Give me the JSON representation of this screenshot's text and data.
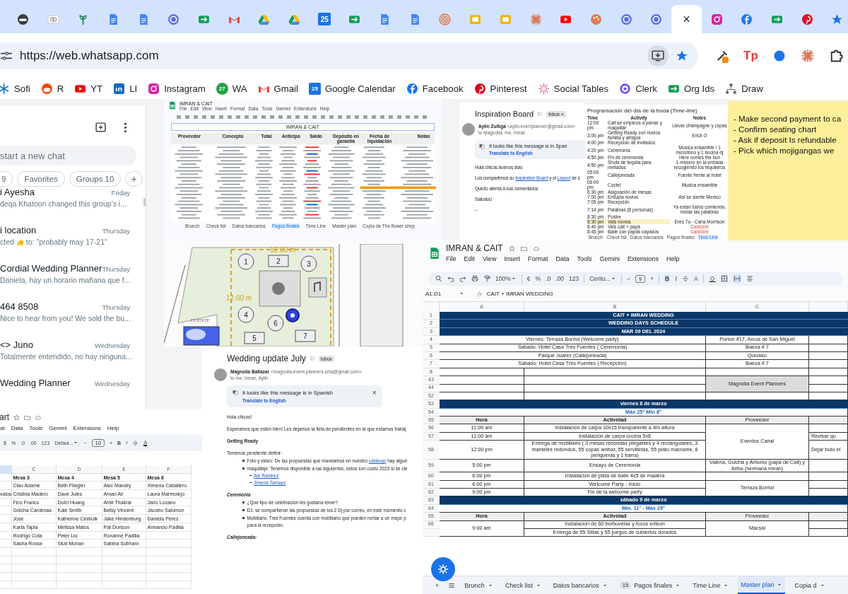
{
  "browser": {
    "tabs": [
      {
        "kind": "mask",
        "selected": false
      },
      {
        "kind": "rings",
        "selected": false
      },
      {
        "kind": "plant",
        "selected": false
      },
      {
        "kind": "doc",
        "selected": false
      },
      {
        "kind": "doc",
        "selected": false
      },
      {
        "kind": "circle",
        "selected": false
      },
      {
        "kind": "meet",
        "selected": false
      },
      {
        "kind": "gmail",
        "selected": false
      },
      {
        "kind": "drive",
        "selected": false
      },
      {
        "kind": "drive",
        "selected": false
      },
      {
        "kind": "calendar",
        "label": "25",
        "selected": false
      },
      {
        "kind": "meet",
        "selected": false
      },
      {
        "kind": "doc",
        "selected": false
      },
      {
        "kind": "doc",
        "selected": false
      },
      {
        "kind": "spiral",
        "selected": false
      },
      {
        "kind": "slides",
        "selected": false
      },
      {
        "kind": "slides",
        "selected": false
      },
      {
        "kind": "burst",
        "selected": false
      },
      {
        "kind": "youtube",
        "selected": false
      },
      {
        "kind": "palette",
        "selected": false
      },
      {
        "kind": "circle",
        "selected": false
      },
      {
        "kind": "circle",
        "selected": false
      },
      {
        "kind": "blank",
        "close": "×",
        "selected": true
      },
      {
        "kind": "instagram",
        "selected": false
      },
      {
        "kind": "facebook",
        "selected": false
      },
      {
        "kind": "meet",
        "selected": false
      },
      {
        "kind": "pinterest",
        "selected": false
      },
      {
        "kind": "star",
        "selected": false
      }
    ],
    "address": {
      "url": "https://web.whatsapp.com"
    },
    "extensions": [
      {
        "kind": "eyedropper"
      },
      {
        "kind": "text",
        "label": "Tp"
      },
      {
        "kind": "dot"
      },
      {
        "kind": "burst"
      },
      {
        "kind": "puzzle"
      }
    ],
    "bookmarks": [
      {
        "label": "Sofi",
        "kind": "snow"
      },
      {
        "label": "R",
        "kind": "reddit"
      },
      {
        "label": "YT",
        "kind": "youtube"
      },
      {
        "label": "LI",
        "kind": "linkedin"
      },
      {
        "label": "Instagram",
        "kind": "instagram"
      },
      {
        "label": "WA",
        "kind": "wa",
        "icon_text": "27"
      },
      {
        "label": "Gmail",
        "kind": "gmail"
      },
      {
        "label": "Google Calendar",
        "kind": "calendar",
        "icon_text": "25"
      },
      {
        "label": "Facebook",
        "kind": "facebook"
      },
      {
        "label": "Pinterest",
        "kind": "pinterest"
      },
      {
        "label": "Social Tables",
        "kind": "sun"
      },
      {
        "label": "Clerk",
        "kind": "clerk"
      },
      {
        "label": "Org Ids",
        "kind": "meet"
      },
      {
        "label": "Draw",
        "kind": "draw"
      }
    ]
  },
  "whatsapp": {
    "search": {
      "placeholder": "start a new chat"
    },
    "filters": [
      {
        "label": "9",
        "selected": false
      },
      {
        "label": "Favorites",
        "selected": false
      },
      {
        "label": "Groups 10",
        "selected": false
      }
    ],
    "add_filter": "+",
    "chats": [
      {
        "name": "i Ayesha",
        "time": "Friday",
        "preview": "deqa Khatoon changed this group's i..."
      },
      {
        "name": "i location",
        "time": "Thursday",
        "preview": "cted",
        "preview_tail": "to: \"probably may 17-21\""
      },
      {
        "name": "Cordial Wedding Planner",
        "time": "Thursday",
        "preview": "Daniela, hay un horario mañana que f..."
      },
      {
        "name": "464 8508",
        "time": "Thursday",
        "preview": "Nice to hear from you! We sold the bu..."
      },
      {
        "name": "<> Juno",
        "time": "Wednesday",
        "preview": "Totalmente entendido, no hay ninguna..."
      },
      {
        "name": "Wedding Planner",
        "time": "Wednesday"
      }
    ]
  },
  "payments_sheet": {
    "title": "IMRAN & CAIT",
    "menu": [
      "File",
      "Edit",
      "View",
      "Insert",
      "Format",
      "Data",
      "Tools",
      "Gemini",
      "Extensions",
      "Help"
    ],
    "sheet_title": "IMRAN & CAIT",
    "columns": [
      "Proveedor",
      "Concepto",
      "Total",
      "Anticipo",
      "Saldo",
      "Depósito en garantía",
      "Fecha de liquidación",
      "Notas"
    ],
    "tabs": [
      {
        "label": "Brunch",
        "selected": false
      },
      {
        "label": "Check list",
        "selected": false
      },
      {
        "label": "Datos bancarios",
        "selected": false
      },
      {
        "label": "Pagos finales",
        "selected": true
      },
      {
        "label": "Time Line",
        "selected": false
      },
      {
        "label": "Master plan",
        "selected": false
      },
      {
        "label": "Copia de The flower shop",
        "selected": false
      }
    ]
  },
  "floor_plan": {
    "tables": [
      {
        "label": "1",
        "kind": "round"
      },
      {
        "label": "2",
        "kind": "long"
      },
      {
        "label": "3",
        "kind": "round"
      },
      {
        "label": "4",
        "kind": "round"
      },
      {
        "label": "5",
        "kind": "long"
      },
      {
        "label": "6",
        "kind": "round"
      },
      {
        "label": "7",
        "kind": "long"
      }
    ],
    "measures": [
      "12.00 m",
      "12.00 m"
    ],
    "area_label": "FUENTE"
  },
  "inspiration_email": {
    "subject": "Inspiration Board",
    "label": "Inbox",
    "label_remove": "×",
    "sender": "Aylin Zuñiga",
    "address": "<aylin.eventplanner@gmail.com>",
    "recipients": "to Magnolia, me, Imran",
    "banner": "It looks like this message is in Span",
    "translate": "Translate to English",
    "body": [
      {
        "parts": [
          {
            "text": "Hola chicos buenos días",
            "link": false
          }
        ]
      },
      {
        "parts": [
          {
            "text": "Los compartimos su ",
            "link": false
          },
          {
            "text": "Inspiration Board",
            "link": true
          },
          {
            "text": " y el ",
            "link": false
          },
          {
            "text": "Layout",
            "link": true
          },
          {
            "text": " de s",
            "link": false
          }
        ]
      },
      {
        "parts": [
          {
            "text": "Quedo atenta a sus comentarios",
            "link": false
          }
        ]
      },
      {
        "parts": [
          {
            "text": "Saludos!",
            "link": false
          }
        ]
      },
      {
        "parts": [
          {
            "text": "--",
            "link": false
          }
        ]
      }
    ]
  },
  "timeline_sheet": {
    "title": "Programación del día de la boda (Time-line)",
    "columns": [
      "Time",
      "Activity",
      "Notes"
    ],
    "rows": [
      {
        "time": "12:00 pm",
        "activity": "Cait se empieza a peinar y maquillar",
        "note": "Llevar champagne y copas",
        "highlighted": false,
        "alert": false
      },
      {
        "time": "3:00 pm",
        "activity": "Getting Ready con novios familia y amigos",
        "note": "Erick O",
        "highlighted": false,
        "alert": false
      },
      {
        "time": "4:00 pm",
        "activity": "Recepcion de invitados",
        "highlighted": false
      },
      {
        "time": "4:20 pm",
        "activity": "Ceremonia",
        "note": "Musica ensamble / 1 microfono y 1 bocina dj",
        "highlighted": false,
        "alert": false
      },
      {
        "time": "4:50 pm",
        "activity": "Fin de ceremonia",
        "note": "Here comes the sun",
        "highlighted": false,
        "alert": false
      },
      {
        "time": "4:50 pm",
        "activity": "Shots de tequila para invitados",
        "note": "1 mesero en la entrada recogiendo los tequileros",
        "highlighted": false,
        "alert": false
      },
      {
        "time": "05:00 pm",
        "activity": "Callejoneada",
        "note": "Fuente frente al hotel",
        "highlighted": false,
        "alert": false
      },
      {
        "time": "06:00 pm",
        "activity": "Coctel",
        "note": "Musica ensamble",
        "highlighted": false,
        "alert": false
      },
      {
        "time": "6:30 pm",
        "activity": "Asignación de mesas",
        "highlighted": false
      },
      {
        "time": "7:00 pm",
        "activity": "Entrada novios",
        "note": "Así se siente Mexico",
        "highlighted": false,
        "alert": false
      },
      {
        "time": "7:05 pm",
        "activity": "Recepción",
        "highlighted": false
      },
      {
        "time": "7:14 pm",
        "activity": "Palabras (8 personas)",
        "note": "Ya estan todos comiendo, iniciar las palabras",
        "highlighted": false,
        "alert": false
      },
      {
        "time": "8:30 pm",
        "activity": "Postre",
        "highlighted": false
      },
      {
        "time": "8:30 pm",
        "activity": "Vals novios",
        "note": "Eres Tu - Carla Morrison",
        "highlighted": true,
        "alert": false
      },
      {
        "time": "8:40 pm",
        "activity": "Vals cait + papá",
        "note": "Canción!",
        "highlighted": false,
        "alert": true
      },
      {
        "time": "8:45 pm",
        "activity": "Baile con papás cayados",
        "note": "Canción!",
        "highlighted": false,
        "alert": true
      }
    ],
    "tabs": [
      {
        "label": "Brunch",
        "selected": false
      },
      {
        "label": "Check list",
        "selected": false
      },
      {
        "label": "Datos bancarios",
        "selected": false
      },
      {
        "label": "Pagos finales",
        "selected": false
      },
      {
        "label": "Time Line",
        "selected": true
      }
    ]
  },
  "sticky_note": {
    "lines": [
      "- Make second payment to ca",
      "- Confirm seating chart",
      "- Ask if deposit Is refundable",
      "- Pick which mojigangas we"
    ]
  },
  "update_email": {
    "subject": "Wedding update July",
    "label": "Inbox",
    "sender": "Magnolia Baltazar",
    "address": "<magnolia.event.planners.sma@gmail.com>",
    "recipients": "to me, Imran, Aylin",
    "banner": "It looks like this message is in Spanish",
    "banner_close": "×",
    "translate": "Translate to English",
    "body": [
      {
        "kind": "text",
        "text": "Hola chicos!"
      },
      {
        "kind": "text",
        "text": "Esperamos que estén bien! Les dejamos la lista de pendientes en la que estamos trabaj"
      },
      {
        "kind": "heading",
        "text": "Getting Ready"
      },
      {
        "kind": "text",
        "text": "Tenemos pendiente definir:"
      },
      {
        "kind": "bullet",
        "parts": [
          {
            "text": "Foto y video: De las propuestas que mandamos en nuestro ",
            "link": false
          },
          {
            "text": "catálogo",
            "link": true
          },
          {
            "text": " hay algun",
            "link": false
          }
        ]
      },
      {
        "kind": "bullet",
        "text": "maquillaje: Tenemos disponible a las siguientes, estos son costo 2023 si se cie"
      },
      {
        "kind": "link",
        "text": "Ale Ramirez"
      },
      {
        "kind": "link",
        "text": "Jimena Tamayo"
      },
      {
        "kind": "subheading",
        "text": "Ceremonia"
      },
      {
        "kind": "bullet",
        "text": "¿Qué tipo de celebración les gustaría tener?"
      },
      {
        "kind": "bullet",
        "text": "DJ: se compartieron las propuestas de los 2 Dj por correo, en este momento c"
      },
      {
        "kind": "bullet",
        "text": "Mobiliario: Tres Fuentes cuenta con mobiliario que pueden rentar a un mejor p"
      },
      {
        "kind": "continued",
        "text": "para la recepción."
      },
      {
        "kind": "subheading",
        "text": "Callejoneada:"
      }
    ]
  },
  "seating_sheet": {
    "title": "art",
    "menu": [
      "at",
      "Data",
      "Tools",
      "Gemini",
      "Extensions",
      "Help"
    ],
    "toolbar": [
      "$",
      "%",
      ".0",
      ".00",
      "123"
    ],
    "font": "Defaul...",
    "font_size": "10",
    "size_minus": "−",
    "size_plus": "+",
    "bold": "B",
    "italic": "I",
    "text_color": "A",
    "columns": [
      "",
      "C",
      "D",
      "E",
      "F"
    ],
    "rows": [
      {
        "kind": "header",
        "cells": [
          "",
          "Mesa 3",
          "Mesa 4",
          "Mesa 5",
          "Mesa 6"
        ]
      },
      {
        "kind": "guest",
        "cells": [
          "",
          "Clau Adame",
          "Beth Fliegler",
          "Alex Mandry",
          "Ximena Caballero"
        ]
      },
      {
        "kind": "guest",
        "cells": [
          "valos",
          "Cristina Madero",
          "Dave Jules",
          "Aman Ali",
          "Laura Marmolejo"
        ]
      },
      {
        "kind": "guest",
        "cells": [
          "",
          "Fico Franco",
          "Dulci Huang",
          "Amit Thakrar",
          "Jairo Lozano"
        ]
      },
      {
        "kind": "guest",
        "cells": [
          "",
          "Gülcha Cardenas",
          "Kale Smith",
          "Betsy Vincent",
          "Jacobo Salomon"
        ]
      },
      {
        "kind": "guest",
        "cells": [
          "",
          "Jose",
          "Katherine Cinibulk",
          "Jake Hindenburg",
          "Daniela Perez"
        ]
      },
      {
        "kind": "guest",
        "cells": [
          "",
          "Karla Tapia",
          "Melissa Matos",
          "Pat Durison",
          "Armando Padilla"
        ]
      },
      {
        "kind": "guest",
        "cells": [
          "",
          "Rodrigo Cota",
          "Peter Liu",
          "Roxanne Padilla",
          ""
        ]
      },
      {
        "kind": "guest",
        "cells": [
          "",
          "Sasha Rosse",
          "Stuti Mohan",
          "Sabina Sobhani",
          ""
        ]
      }
    ]
  },
  "master_sheet": {
    "title": "IMRAN & CAIT",
    "menu": [
      "File",
      "Edit",
      "View",
      "Insert",
      "Format",
      "Data",
      "Tools",
      "Gemini",
      "Extensions",
      "Help"
    ],
    "toolbar": {
      "zoom": "100%",
      "currency": "€",
      "percent": "%",
      "dec_less": ".0",
      "dec_more": ".00",
      "number": "123",
      "font": "Centu...",
      "size_minus": "−",
      "font_size": "9",
      "size_plus": "+",
      "bold": "B",
      "italic": "I",
      "text_color": "A"
    },
    "cell_ref": "A1:D1",
    "fx": "fx",
    "formula": "CAIT + IMRAN  WEDDING",
    "columns": [
      "A",
      "B",
      "C"
    ],
    "rows": [
      {
        "num": "1",
        "kind": "banner",
        "text": "CAIT + IMRAN  WEDDING"
      },
      {
        "num": "2",
        "kind": "banner",
        "text": "WEDDING DAYS SCHEDULE"
      },
      {
        "num": "3",
        "kind": "banner",
        "text": "MAR 09 DEL 2024"
      },
      {
        "num": "4",
        "kind": "venue",
        "place": "Viernes: Terraza Borriol (Welcome party)",
        "address": "Porton #17, Arcos de San Miguel"
      },
      {
        "num": "5",
        "kind": "venue",
        "place": "Sabado: Hotel Casa Tres Fuentes ( Ceremonia)",
        "address": "Baeza # 7"
      },
      {
        "num": "6",
        "kind": "venue",
        "place": "Parque Juarez (Callejoneada)",
        "address": "Quiosko"
      },
      {
        "num": "7",
        "kind": "venue",
        "place": "Sabado: Hotel Casa Tres Fuentes ( Recepción)",
        "address": "Baeza # 7"
      },
      {
        "num": "8",
        "kind": "blank"
      },
      {
        "num": "43",
        "kind": "blank",
        "note": "Magnolia Event Planners"
      },
      {
        "num": "44",
        "kind": "blank"
      },
      {
        "num": "52",
        "kind": "blank"
      },
      {
        "num": "53",
        "kind": "section",
        "text": "viernes 8 de marzo"
      },
      {
        "num": "54",
        "kind": "weather",
        "text": "Máx 25°  Min 8°"
      },
      {
        "num": "55",
        "kind": "header",
        "cells": [
          "Hora",
          "Actividad",
          "Proveedor"
        ]
      },
      {
        "num": "56",
        "kind": "activity",
        "time": "11:00 am",
        "activity": "Instalacion de carpa 10x15 transparente a 4m altura",
        "provider": "Eventos Canal"
      },
      {
        "num": "57",
        "kind": "activity",
        "time": "11:00 am",
        "activity": "Instalación de carpa cocina 5x6",
        "extra": "Revisar qu"
      },
      {
        "num": "58",
        "kind": "activity",
        "time": "12:00 pm",
        "activity": "Entrega de mobiliario ( 3 mesas redondas plegables y 4 rectangulares, 3 manteles redondos, 55 copas ambar, 55 servilletas, 55 plato macrame,  6 periqueras y 1 barra)",
        "extra": "Dejar todo el"
      },
      {
        "num": "59",
        "kind": "activity",
        "time": "5:00 pm",
        "activity": "Ensayo de Ceremonia",
        "provider": "Valeria, Guicha y Antonio (papá de Cait) y Ariba (hermana Imran)"
      },
      {
        "num": "60",
        "kind": "activity",
        "time": "6:00 pm",
        "activity": "Instalación de pista de baile 4x5 de madera"
      },
      {
        "num": "61",
        "kind": "activity",
        "time": "6:00 pm",
        "activity": "Welcome Party - Inicio",
        "provider": "Terraza Borriol"
      },
      {
        "num": "62",
        "kind": "activity",
        "time": "9:00 pm",
        "activity": "Fin de la welcome party"
      },
      {
        "num": "63",
        "kind": "section",
        "text": "sábado 9 de marzo"
      },
      {
        "num": "64",
        "kind": "weather",
        "text": "Mín. 11° - Max 29°"
      },
      {
        "num": "65",
        "kind": "header",
        "cells": [
          "Hora",
          "Actividad",
          "Proveedor"
        ]
      },
      {
        "num": "66",
        "kind": "activity",
        "time": "9:00 am",
        "activity": "Instalación de 60 burbuvelas y focos edison",
        "provider": "Macsai"
      },
      {
        "kind": "activity",
        "activity": "Entrega de 55 Sillas y 55 juegos de cubiertos dorados"
      }
    ],
    "add_sheet": "+",
    "tabs": [
      {
        "label": "Brunch",
        "selected": false
      },
      {
        "label": "Check list",
        "selected": false
      },
      {
        "label": "Datos bancarios",
        "selected": false
      },
      {
        "label": "Pagos finales",
        "badge": "15",
        "selected": false
      },
      {
        "label": "Time Line",
        "selected": false
      },
      {
        "label": "Master plan",
        "selected": true
      },
      {
        "label": "Copia d",
        "selected": false
      }
    ]
  }
}
